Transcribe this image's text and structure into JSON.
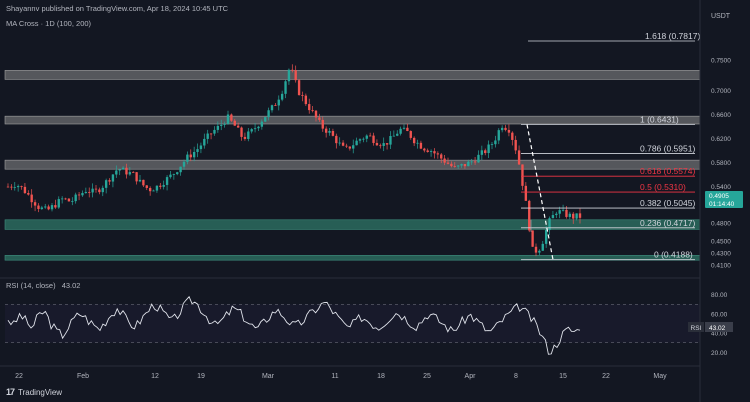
{
  "header": {
    "publisher_line": "Shayannv published on TradingView.com, Apr 18, 2024 10:45 UTC",
    "symbol_line": "MA Cross · 1D (100, 200)"
  },
  "currency": "USDT",
  "rsi": {
    "label": "RSI (14, close)",
    "value_text": "43.02",
    "badge_tag": "RSI",
    "badge_value": "43.02"
  },
  "brand": {
    "name": "TradingView",
    "logo_text": "17"
  },
  "price_badge": {
    "price": "0.4905",
    "countdown": "01:14:40"
  },
  "colors": {
    "background": "#131722",
    "bull": "#26a69a",
    "bear": "#ef5350",
    "zone_grey": "#8c8c8c",
    "zone_teal": "#2b6b5e",
    "fib_white": "#d1d4dc",
    "fib_red": "#f23645",
    "rsi_line": "#e0e3eb"
  },
  "chart_data": [
    {
      "type": "candlestick",
      "title": "",
      "y_axis": {
        "scale": "linear",
        "ticks": [
          "0.7500",
          "0.7000",
          "0.6600",
          "0.6200",
          "0.5800",
          "0.5400",
          "0.5100",
          "0.4800",
          "0.4500",
          "0.4300",
          "0.4100"
        ]
      },
      "x_axis": {
        "ticks": [
          "22",
          "Feb",
          "12",
          "19",
          "Mar",
          "11",
          "18",
          "25",
          "Apr",
          "8",
          "15",
          "22",
          "May"
        ]
      },
      "ylim": [
        0.405,
        0.8
      ],
      "series_trend": [
        0.54,
        0.545,
        0.535,
        0.52,
        0.505,
        0.5,
        0.51,
        0.52,
        0.515,
        0.525,
        0.535,
        0.53,
        0.54,
        0.555,
        0.57,
        0.565,
        0.56,
        0.545,
        0.535,
        0.54,
        0.55,
        0.56,
        0.575,
        0.59,
        0.6,
        0.615,
        0.63,
        0.64,
        0.655,
        0.64,
        0.62,
        0.63,
        0.645,
        0.66,
        0.675,
        0.7,
        0.74,
        0.7,
        0.68,
        0.66,
        0.64,
        0.63,
        0.615,
        0.6,
        0.61,
        0.62,
        0.625,
        0.615,
        0.61,
        0.62,
        0.635,
        0.63,
        0.615,
        0.605,
        0.6,
        0.59,
        0.58,
        0.57,
        0.575,
        0.58,
        0.59,
        0.6,
        0.615,
        0.643,
        0.635,
        0.595,
        0.52,
        0.43,
        0.44,
        0.48,
        0.5,
        0.495,
        0.49,
        0.4905
      ],
      "zones": [
        {
          "kind": "resistance",
          "from": 0.718,
          "to": 0.733
        },
        {
          "kind": "resistance",
          "from": 0.644,
          "to": 0.657
        },
        {
          "kind": "resistance",
          "from": 0.569,
          "to": 0.584
        },
        {
          "kind": "support",
          "from": 0.469,
          "to": 0.485
        },
        {
          "kind": "support",
          "from": 0.418,
          "to": 0.426
        }
      ],
      "fib_levels": [
        {
          "label": "1.618 (0.7817)",
          "value": 0.7817,
          "color": "white"
        },
        {
          "label": "1 (0.6431)",
          "value": 0.6431,
          "color": "white"
        },
        {
          "label": "0.786 (0.5951)",
          "value": 0.5951,
          "color": "white"
        },
        {
          "label": "0.618 (0.5574)",
          "value": 0.5574,
          "color": "red"
        },
        {
          "label": "0.5 (0.5310)",
          "value": 0.531,
          "color": "red"
        },
        {
          "label": "0.382 (0.5045)",
          "value": 0.5045,
          "color": "white"
        },
        {
          "label": "0.236 (0.4717)",
          "value": 0.4717,
          "color": "white"
        },
        {
          "label": "0 (0.4188)",
          "value": 0.4188,
          "color": "white"
        }
      ]
    },
    {
      "type": "line",
      "title": "",
      "ylim": [
        10,
        90
      ],
      "y_axis": {
        "ticks": [
          "80.00",
          "60.00",
          "40.00",
          "20.00"
        ]
      },
      "reference_lines": [
        70,
        30
      ],
      "series": [
        {
          "values": [
            55,
            48,
            60,
            52,
            45,
            58,
            63,
            50,
            42,
            38,
            47,
            56,
            61,
            54,
            49,
            44,
            52,
            60,
            66,
            58,
            50,
            47,
            55,
            63,
            70,
            65,
            58,
            52,
            60,
            68,
            75,
            71,
            63,
            55,
            48,
            52,
            59,
            66,
            62,
            55,
            48,
            44,
            51,
            58,
            64,
            60,
            53,
            47,
            50,
            56,
            62,
            67,
            72,
            66,
            58,
            50,
            45,
            51,
            57,
            54,
            49,
            46,
            52,
            58,
            62,
            57,
            52,
            47,
            53,
            60,
            57,
            52,
            47,
            42,
            48,
            54,
            59,
            53,
            47,
            41,
            45,
            52,
            58,
            63,
            68,
            62,
            55,
            46,
            34,
            20,
            27,
            38,
            44,
            42,
            43.02
          ]
        }
      ]
    }
  ]
}
